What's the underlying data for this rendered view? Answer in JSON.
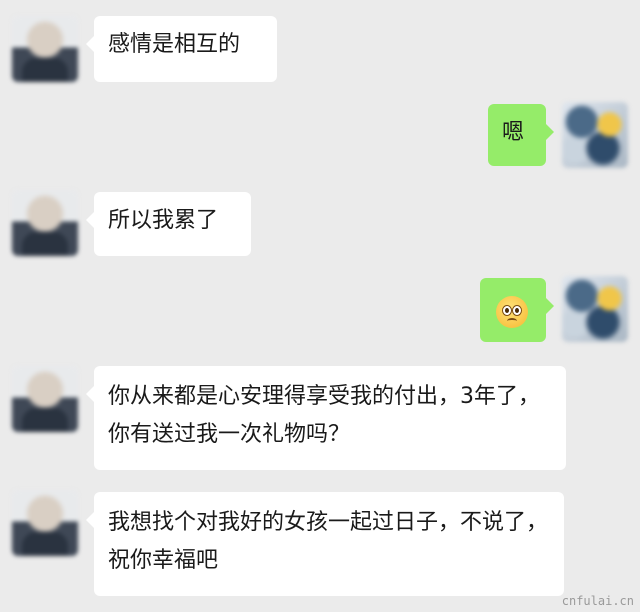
{
  "messages": [
    {
      "side": "left",
      "text": "感情是相互的"
    },
    {
      "side": "right",
      "text": "嗯"
    },
    {
      "side": "left",
      "text": "所以我累了"
    },
    {
      "side": "right",
      "emoji": "worried-face-emoji"
    },
    {
      "side": "left",
      "text": "你从来都是心安理得享受我的付出，3年了，你有送过我一次礼物吗？"
    },
    {
      "side": "left",
      "text": "我想找个对我好的女孩一起过日子，不说了，祝你幸福吧"
    }
  ],
  "watermark": "cnfulai.cn",
  "colors": {
    "background": "#ebebeb",
    "incoming_bubble": "#ffffff",
    "outgoing_bubble": "#95ec69"
  }
}
